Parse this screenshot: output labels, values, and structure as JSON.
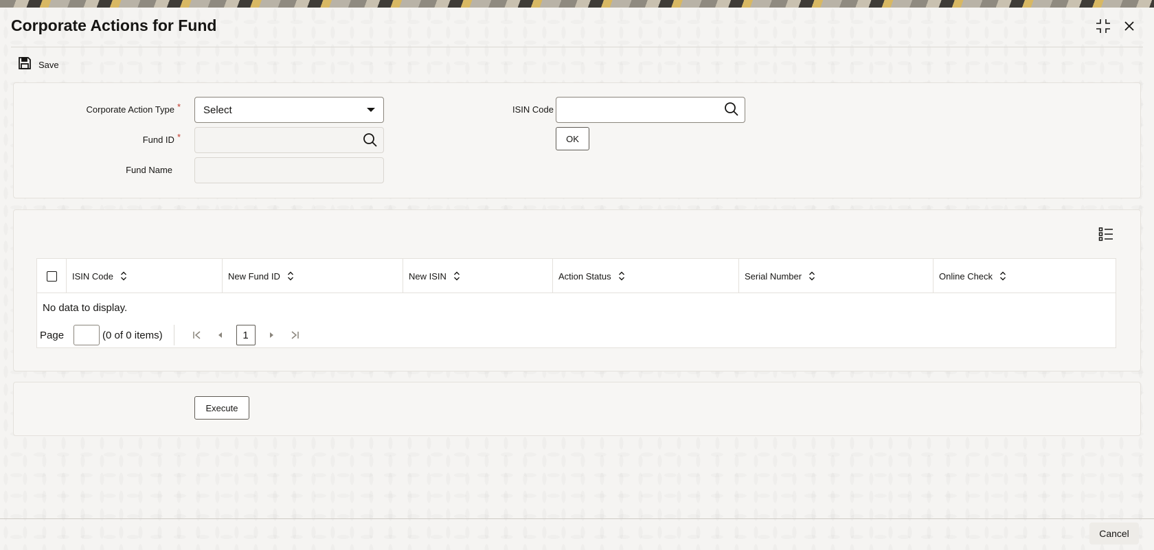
{
  "window": {
    "title": "Corporate Actions for Fund",
    "icons": [
      "collapse-icon",
      "close-icon"
    ]
  },
  "toolbar": {
    "save_label": "Save",
    "save_icon": "floppy-disk-icon"
  },
  "form": {
    "corporate_action_type": {
      "label": "Corporate Action Type",
      "required_mark": "*",
      "value": "Select"
    },
    "fund_id": {
      "label": "Fund ID",
      "required_mark": "*",
      "value": ""
    },
    "fund_name": {
      "label": "Fund Name",
      "value": ""
    },
    "isin_code": {
      "label": "ISIN Code",
      "value": ""
    },
    "ok_label": "OK"
  },
  "grid": {
    "columns": [
      {
        "label": "ISIN Code"
      },
      {
        "label": "New Fund ID"
      },
      {
        "label": "New ISIN"
      },
      {
        "label": "Action Status"
      },
      {
        "label": "Serial Number"
      },
      {
        "label": "Online Check"
      }
    ],
    "rows": [],
    "empty_text": "No data to display.",
    "pager": {
      "page_label": "Page",
      "page_value": "",
      "items_text": "(0 of 0 items)",
      "current_page": "1"
    }
  },
  "actions": {
    "execute_label": "Execute",
    "cancel_label": "Cancel"
  },
  "colors": {
    "required": "#c0392b",
    "text": "#161513",
    "panel_bg": "#f7f6f4"
  }
}
